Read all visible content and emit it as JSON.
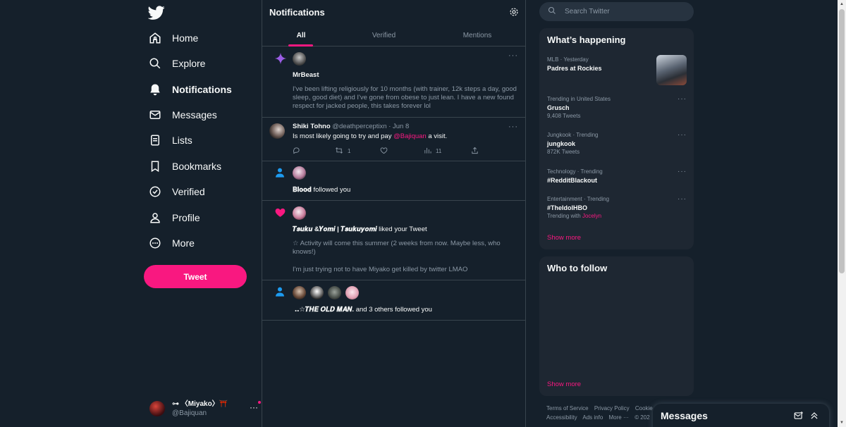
{
  "nav": {
    "items": [
      {
        "label": "Home",
        "icon": "home-icon"
      },
      {
        "label": "Explore",
        "icon": "search-icon"
      },
      {
        "label": "Notifications",
        "icon": "bell-icon"
      },
      {
        "label": "Messages",
        "icon": "envelope-icon"
      },
      {
        "label": "Lists",
        "icon": "list-icon"
      },
      {
        "label": "Bookmarks",
        "icon": "bookmark-icon"
      },
      {
        "label": "Verified",
        "icon": "verified-icon"
      },
      {
        "label": "Profile",
        "icon": "person-icon"
      },
      {
        "label": "More",
        "icon": "more-circle-icon"
      }
    ],
    "tweet_label": "Tweet",
    "account": {
      "name": "⊶ 〈Miyako〉⛩️",
      "handle": "@Bajiquan",
      "more": "···"
    }
  },
  "center": {
    "title": "Notifications",
    "tabs": [
      "All",
      "Verified",
      "Mentions"
    ],
    "notifications": {
      "n1": {
        "name": "MrBeast",
        "body": "I've been lifting religiously for 10 months (with trainer, 12k steps a day, good sleep, good diet) and I've gone from obese to just lean. I have a new found respect for jacked people, this takes forever lol"
      },
      "n2": {
        "name": "Shiki Tohno",
        "handle": "@deathperceptixn",
        "sep": "·",
        "date": "Jun 8",
        "text_before": "Is most likely going to try and pay ",
        "mention": "@Bajiquan",
        "text_after": " a visit.",
        "retweets": "1",
        "views": "11"
      },
      "n3": {
        "name": "𝐁𝐥𝐨𝐨𝐝",
        "action": " followed you"
      },
      "n4": {
        "name": "𝑻𝒔𝒖𝒌𝒖 &𝒀𝒐𝒎𝒊 | 𝑻𝒔𝒖𝒌𝒖𝒚𝒐𝒎𝒊",
        "action": " liked your Tweet",
        "body1": "☆ Activity will come this summer (2 weeks from now. Maybe less, who knows!)",
        "body2": "I'm just trying not to have Miyako get killed by twitter LMAO"
      },
      "n5": {
        "name": "‥☆𝑻𝑯𝑬 𝑶𝑳𝑫 𝑴𝑨𝑵.",
        "action": " and 3 others followed you"
      }
    },
    "more": "···"
  },
  "right": {
    "search_placeholder": "Search Twitter",
    "happening": {
      "title": "What’s happening",
      "trends": [
        {
          "meta": "MLB · Yesterday",
          "name": "Padres at Rockies",
          "count": ""
        },
        {
          "meta": "Trending in United States",
          "name": "Grusch",
          "count": "9,408 Tweets"
        },
        {
          "meta": "Jungkook · Trending",
          "name": "jungkook",
          "count": "872K Tweets"
        },
        {
          "meta": "Technology · Trending",
          "name": "#RedditBlackout",
          "count": ""
        },
        {
          "meta": "Entertainment · Trending",
          "name": "#TheIdolHBO",
          "count": "Trending with ",
          "with": "Jocelyn"
        }
      ],
      "show_more": "Show more"
    },
    "follow": {
      "title": "Who to follow",
      "show_more": "Show more"
    },
    "footer": {
      "links1": [
        "Terms of Service",
        "Privacy Policy",
        "Cookie"
      ],
      "links2": [
        "Accessibility",
        "Ads info",
        "More ···",
        "© 202"
      ]
    }
  },
  "messages": {
    "title": "Messages"
  },
  "colors": {
    "accent": "#f91880",
    "background": "#15202b",
    "panel": "#1e2732",
    "border": "#38444d",
    "muted": "#8b98a5"
  }
}
